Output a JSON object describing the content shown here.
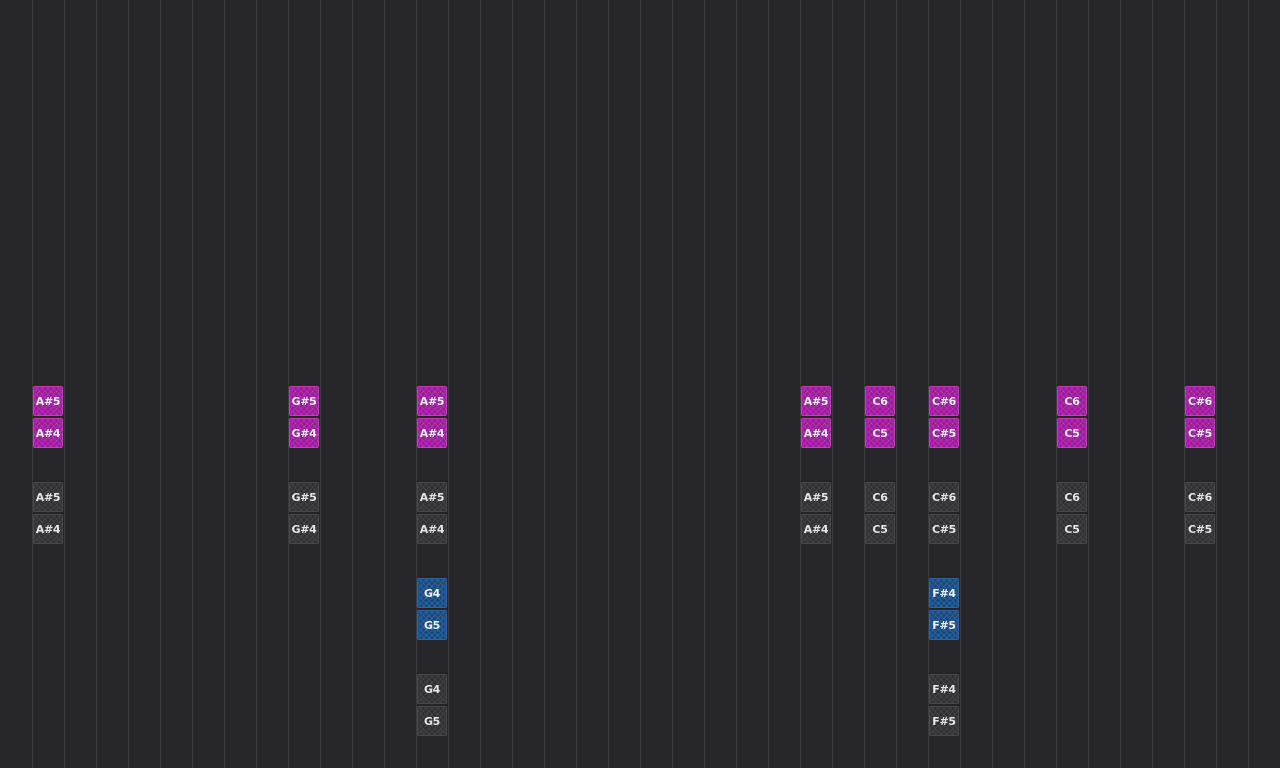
{
  "colors": {
    "background": "#262628",
    "gridline": "#3c3c3f",
    "magenta": "#a0179f",
    "gray": "#303033",
    "blue": "#134a86"
  },
  "columns": [
    {
      "id": "c1",
      "notes": [
        {
          "label": "A#5",
          "style": "magenta"
        },
        {
          "label": "A#4",
          "style": "magenta"
        },
        {
          "label": "A#5",
          "style": "gray"
        },
        {
          "label": "A#4",
          "style": "gray"
        }
      ]
    },
    {
      "id": "c9",
      "notes": [
        {
          "label": "G#5",
          "style": "magenta"
        },
        {
          "label": "G#4",
          "style": "magenta"
        },
        {
          "label": "G#5",
          "style": "gray"
        },
        {
          "label": "G#4",
          "style": "gray"
        }
      ]
    },
    {
      "id": "c13",
      "notes": [
        {
          "label": "A#5",
          "style": "magenta"
        },
        {
          "label": "A#4",
          "style": "magenta"
        },
        {
          "label": "A#5",
          "style": "gray"
        },
        {
          "label": "A#4",
          "style": "gray"
        },
        {
          "label": "G4",
          "style": "blue"
        },
        {
          "label": "G5",
          "style": "blue"
        },
        {
          "label": "G4",
          "style": "gray"
        },
        {
          "label": "G5",
          "style": "gray"
        }
      ]
    },
    {
      "id": "c25",
      "notes": [
        {
          "label": "A#5",
          "style": "magenta"
        },
        {
          "label": "A#4",
          "style": "magenta"
        },
        {
          "label": "A#5",
          "style": "gray"
        },
        {
          "label": "A#4",
          "style": "gray"
        }
      ]
    },
    {
      "id": "c27",
      "notes": [
        {
          "label": "C6",
          "style": "magenta"
        },
        {
          "label": "C5",
          "style": "magenta"
        },
        {
          "label": "C6",
          "style": "gray"
        },
        {
          "label": "C5",
          "style": "gray"
        }
      ]
    },
    {
      "id": "c29",
      "notes": [
        {
          "label": "C#6",
          "style": "magenta"
        },
        {
          "label": "C#5",
          "style": "magenta"
        },
        {
          "label": "C#6",
          "style": "gray"
        },
        {
          "label": "C#5",
          "style": "gray"
        },
        {
          "label": "F#4",
          "style": "blue"
        },
        {
          "label": "F#5",
          "style": "blue"
        },
        {
          "label": "F#4",
          "style": "gray"
        },
        {
          "label": "F#5",
          "style": "gray"
        }
      ]
    },
    {
      "id": "c33",
      "notes": [
        {
          "label": "C6",
          "style": "magenta"
        },
        {
          "label": "C5",
          "style": "magenta"
        },
        {
          "label": "C6",
          "style": "gray"
        },
        {
          "label": "C5",
          "style": "gray"
        }
      ]
    },
    {
      "id": "c37",
      "notes": [
        {
          "label": "C#6",
          "style": "magenta"
        },
        {
          "label": "C#5",
          "style": "magenta"
        },
        {
          "label": "C#6",
          "style": "gray"
        },
        {
          "label": "C#5",
          "style": "gray"
        }
      ]
    }
  ]
}
